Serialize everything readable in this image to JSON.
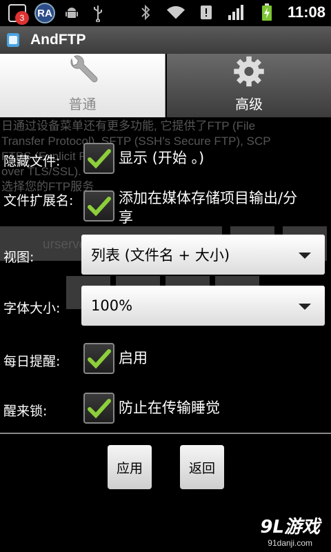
{
  "status_bar": {
    "notification_count": "3",
    "ra_icon_text": "RA",
    "time": "11:08"
  },
  "app": {
    "title": "AndFTP"
  },
  "tabs": [
    {
      "label": "普通",
      "icon": "wrench-icon",
      "active": true
    },
    {
      "label": "高级",
      "icon": "gear-icon",
      "active": false
    }
  ],
  "background_text": {
    "line1": "日通过设备菜单还有更多功能, 它提供了FTP (File",
    "line2": "Transfer Protocol), SFTP (SSH's Secure FTP), SCP",
    "line3": "                     FTPS (Explicit FTP",
    "line4": "over TLS/SSL).",
    "line5": "选择您的FTP服务",
    "line6": "urserve"
  },
  "form": {
    "hidden_files": {
      "label": "隐藏文件:",
      "checked": true,
      "text": "显示 (开始 。)"
    },
    "file_ext": {
      "label": "文件扩展名:",
      "checked": true,
      "text_line1": "添加在媒体存储项目输出/分",
      "text_line2": "享"
    },
    "view": {
      "label": "视图:",
      "value": "列表 (文件名 + 大小)"
    },
    "font_size": {
      "label": "字体大小:",
      "value": "100%"
    },
    "daily_reminder": {
      "label": "每日提醒:",
      "checked": true,
      "text": "启用"
    },
    "wake_lock": {
      "label": "醒来锁:",
      "checked": true,
      "text": "防止在传输睡觉"
    }
  },
  "buttons": {
    "apply": "应用",
    "back": "返回"
  },
  "watermark": {
    "main": "9L游戏",
    "sub": "91danji.com"
  },
  "colors": {
    "check_green": "#8ccf3a",
    "badge_red": "#dd3333"
  }
}
